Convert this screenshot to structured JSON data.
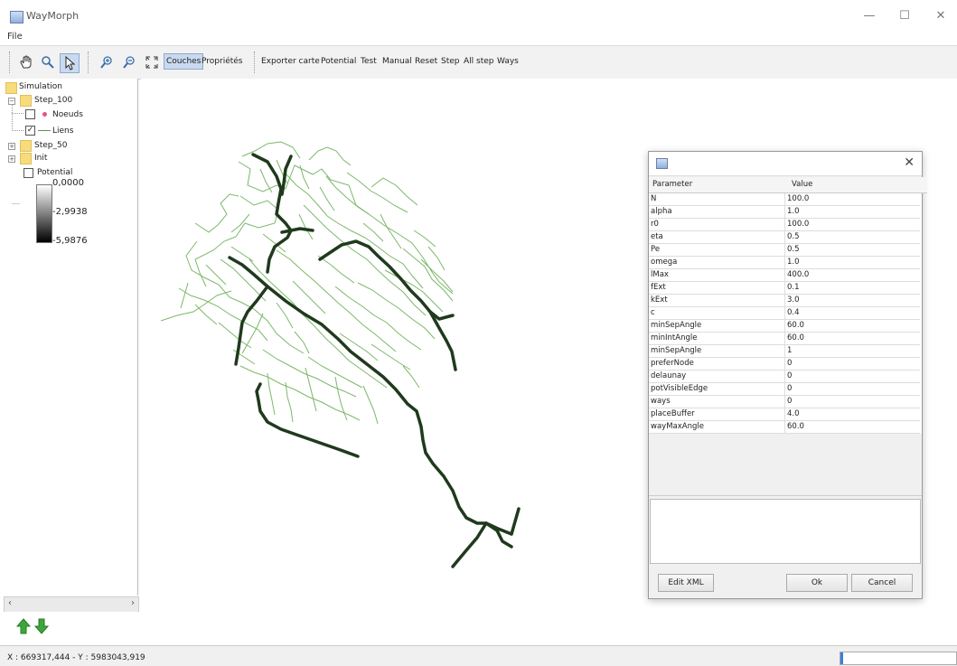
{
  "window": {
    "title": "WayMorph"
  },
  "menu": {
    "file": "File"
  },
  "toolbar": {
    "items": [
      "Couches",
      "Propriétés",
      "Exporter carte",
      "Potential",
      "Test",
      "Manual",
      "Reset",
      "Step",
      "All step",
      "Ways"
    ]
  },
  "layers": {
    "simulation": "Simulation",
    "step100": "Step_100",
    "noeuds": "Noeuds",
    "liens": "Liens",
    "step50": "Step_50",
    "init": "Init",
    "potential": "Potential",
    "legend_top": "0,0000",
    "legend_mid": "-2,9938",
    "legend_bottom": "-5,9876",
    "noeuds_checked": false,
    "liens_checked": true,
    "potential_checked": false
  },
  "status": {
    "coords": "X : 669317,444 - Y : 5983043,919",
    "progress": 0.02
  },
  "colors": {
    "minor_road": "#7db86a",
    "major_road": "#1f3a1c",
    "selected_tool": "#c9daf0"
  },
  "dialog": {
    "headers": [
      "Parameter",
      "Value"
    ],
    "rows": [
      [
        "N",
        "100.0"
      ],
      [
        "alpha",
        "1.0"
      ],
      [
        "r0",
        "100.0"
      ],
      [
        "eta",
        "0.5"
      ],
      [
        "Pe",
        "0.5"
      ],
      [
        "omega",
        "1.0"
      ],
      [
        "lMax",
        "400.0"
      ],
      [
        "fExt",
        "0.1"
      ],
      [
        "kExt",
        "3.0"
      ],
      [
        "c",
        "0.4"
      ],
      [
        "minSepAngle",
        "60.0"
      ],
      [
        "minIntAngle",
        "60.0"
      ],
      [
        "minSepAngle",
        "1"
      ],
      [
        "preferNode",
        "0"
      ],
      [
        "delaunay",
        "0"
      ],
      [
        "potVisibleEdge",
        "0"
      ],
      [
        "ways",
        "0"
      ],
      [
        "placeBuffer",
        "4.0"
      ],
      [
        "wayMaxAngle",
        "60.0"
      ]
    ],
    "buttons": {
      "edit_xml": "Edit XML",
      "ok": "Ok",
      "cancel": "Cancel"
    }
  }
}
